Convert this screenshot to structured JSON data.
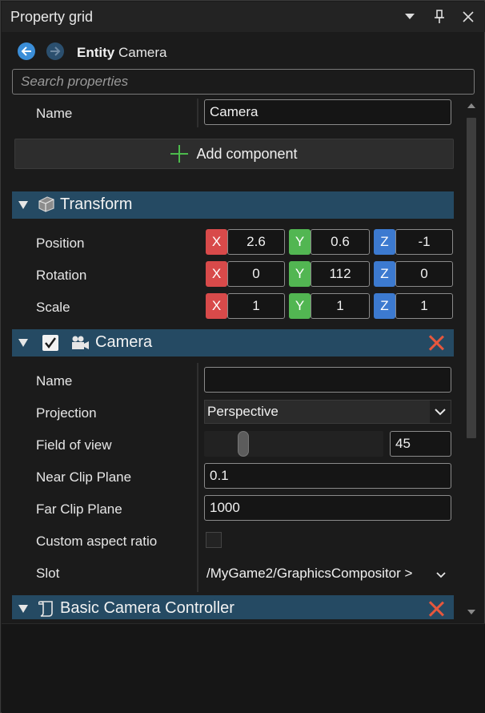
{
  "window": {
    "title": "Property grid"
  },
  "nav": {
    "entity_kind": "Entity",
    "entity_name": "Camera"
  },
  "search": {
    "placeholder": "Search properties",
    "value": ""
  },
  "entity": {
    "name_label": "Name",
    "name_value": "Camera",
    "add_component_label": "Add component"
  },
  "transform": {
    "title": "Transform",
    "axis_labels": {
      "x": "X",
      "y": "Y",
      "z": "Z"
    },
    "position": {
      "label": "Position",
      "x": "2.6",
      "y": "0.6",
      "z": "-1"
    },
    "rotation": {
      "label": "Rotation",
      "x": "0",
      "y": "112",
      "z": "0"
    },
    "scale": {
      "label": "Scale",
      "x": "1",
      "y": "1",
      "z": "1"
    }
  },
  "camera": {
    "title": "Camera",
    "enabled": true,
    "name": {
      "label": "Name",
      "value": ""
    },
    "projection": {
      "label": "Projection",
      "value": "Perspective"
    },
    "fov": {
      "label": "Field of view",
      "value": "45",
      "slider_fraction": 0.2
    },
    "near": {
      "label": "Near Clip Plane",
      "value": "0.1"
    },
    "far": {
      "label": "Far Clip Plane",
      "value": "1000"
    },
    "aspect": {
      "label": "Custom aspect ratio",
      "checked": false
    },
    "slot": {
      "label": "Slot",
      "value": "/MyGame2/GraphicsCompositor >"
    }
  },
  "controller": {
    "title": "Basic Camera Controller"
  },
  "colors": {
    "section_header": "#254a63",
    "axis_x": "#d84a4a",
    "axis_y": "#52b652",
    "axis_z": "#3c7ad0",
    "remove": "#e6573d",
    "add": "#4cbb4c",
    "nav_back": "#3b8ed8"
  },
  "icons": {
    "title_dropdown": "chevron-down-icon",
    "title_pin": "pin-icon",
    "title_close": "close-icon",
    "nav_back": "back-arrow-icon",
    "nav_forward": "forward-arrow-icon",
    "add": "plus-icon",
    "transform": "transform-cube-icon",
    "camera": "camera-icon",
    "controller": "script-icon",
    "remove": "remove-x-icon"
  }
}
